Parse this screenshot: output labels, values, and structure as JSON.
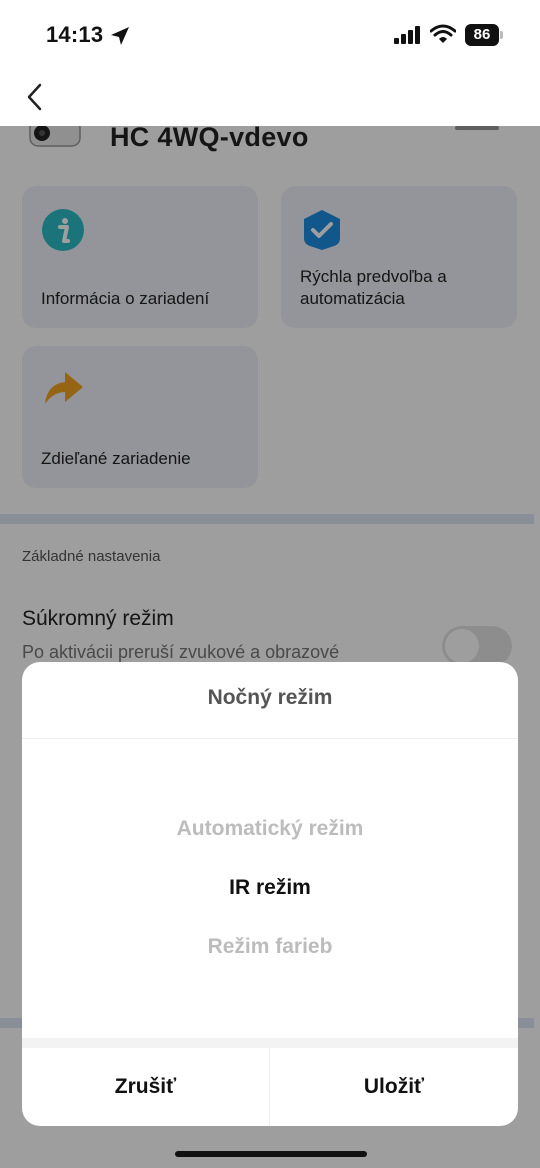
{
  "status_bar": {
    "time": "14:13",
    "battery": "86",
    "icons": [
      "location-arrow-icon",
      "signal-icon",
      "wifi-icon",
      "battery-icon"
    ]
  },
  "nav": {
    "back_icon": "chevron-left-icon"
  },
  "device": {
    "name": "HC 4WQ-vdevo"
  },
  "cards": [
    {
      "label": "Informácia o zariadení",
      "icon": "info-icon",
      "color": "#2bbcc5"
    },
    {
      "label_line1": "Rýchla predvoľba a",
      "label_line2": "automatizácia",
      "icon": "checkmark-shield-icon",
      "color": "#1e8de0"
    },
    {
      "label": "Zdieľané zariadenie",
      "icon": "share-arrow-icon",
      "color": "#f0a321"
    }
  ],
  "settings": {
    "section_title": "Základné nastavenia",
    "privacy_title": "Súkromný režim",
    "privacy_desc": "Po aktivácii preruší zvukové a obrazové",
    "privacy_enabled": false
  },
  "dialog": {
    "title": "Nočný režim",
    "options": [
      "Automatický režim",
      "IR režim",
      "Režim farieb"
    ],
    "selected": "IR režim",
    "cancel_label": "Zrušiť",
    "save_label": "Uložiť"
  },
  "colors": {
    "overlay": "rgba(0,0,0,0.38)",
    "card_bg": "#eef1f9",
    "divider": "#dde5f6"
  }
}
